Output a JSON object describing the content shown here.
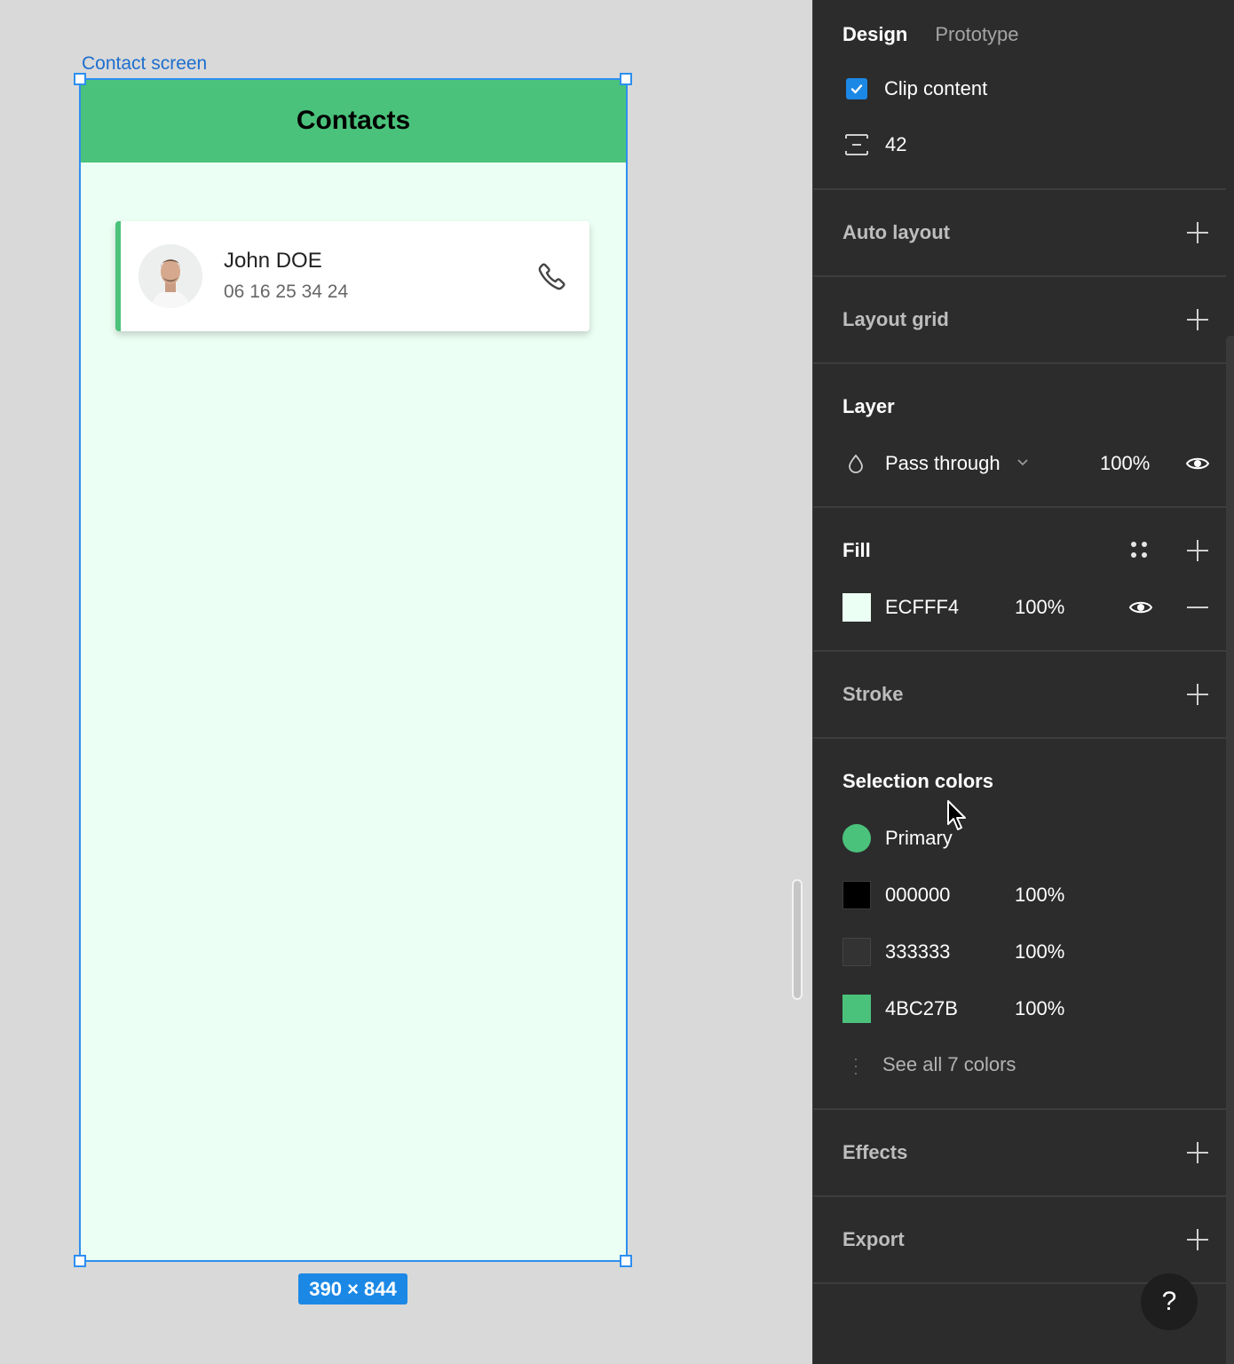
{
  "canvas": {
    "frame_label": "Contact screen",
    "frame_size": "390 × 844",
    "frame_fill": "#ECFFF4",
    "app": {
      "title": "Contacts",
      "header_color": "#4BC27B",
      "contact": {
        "name": "John DOE",
        "phone": "06 16 25 34 24",
        "avatar_icon": "avatar-photo",
        "action_icon": "phone-icon"
      }
    }
  },
  "panel": {
    "tabs": [
      "Design",
      "Prototype"
    ],
    "active_tab": "Design",
    "clip_content": {
      "label": "Clip content",
      "checked": true
    },
    "spacing": {
      "icon": "spacing-icon",
      "value": "42"
    },
    "sections": {
      "auto_layout": "Auto layout",
      "layout_grid": "Layout grid",
      "layer": "Layer",
      "fill": "Fill",
      "stroke": "Stroke",
      "selection_colors": "Selection colors",
      "effects": "Effects",
      "export": "Export"
    },
    "layer": {
      "blend_mode": "Pass through",
      "opacity": "100%",
      "icon": "drop-icon"
    },
    "fill": {
      "hex": "ECFFF4",
      "opacity": "100%",
      "color": "#ECFFF4"
    },
    "selection_colors": {
      "primary": {
        "label": "Primary",
        "color": "#4BC27B"
      },
      "colors": [
        {
          "hex": "000000",
          "opacity": "100%",
          "color": "#000000"
        },
        {
          "hex": "333333",
          "opacity": "100%",
          "color": "#333333"
        },
        {
          "hex": "4BC27B",
          "opacity": "100%",
          "color": "#4BC27B"
        }
      ],
      "see_all": "See all 7 colors"
    },
    "help": "?"
  }
}
